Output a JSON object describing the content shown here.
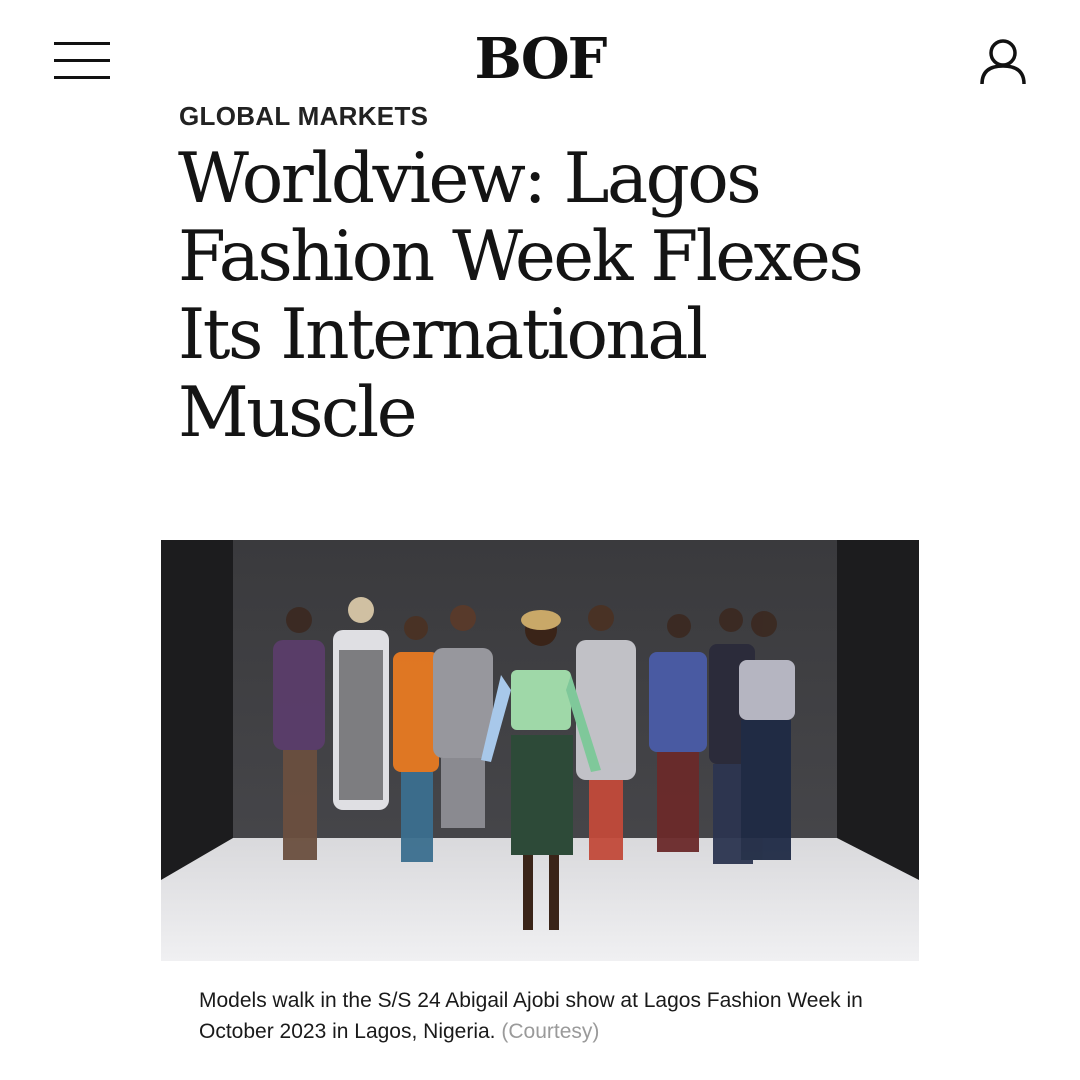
{
  "header": {
    "logo_text": "BOF",
    "menu_icon": "hamburger-menu-icon",
    "account_icon": "user-account-icon"
  },
  "article": {
    "kicker": "GLOBAL MARKETS",
    "headline": "Worldview: Lagos Fashion Week Flexes Its International Muscle",
    "image_description_icon": "runway-photo",
    "caption": "Models walk in the S/S 24 Abigail Ajobi show at Lagos Fashion Week in October 2023 in Lagos, Nigeria.",
    "credit": "(Courtesy)"
  }
}
